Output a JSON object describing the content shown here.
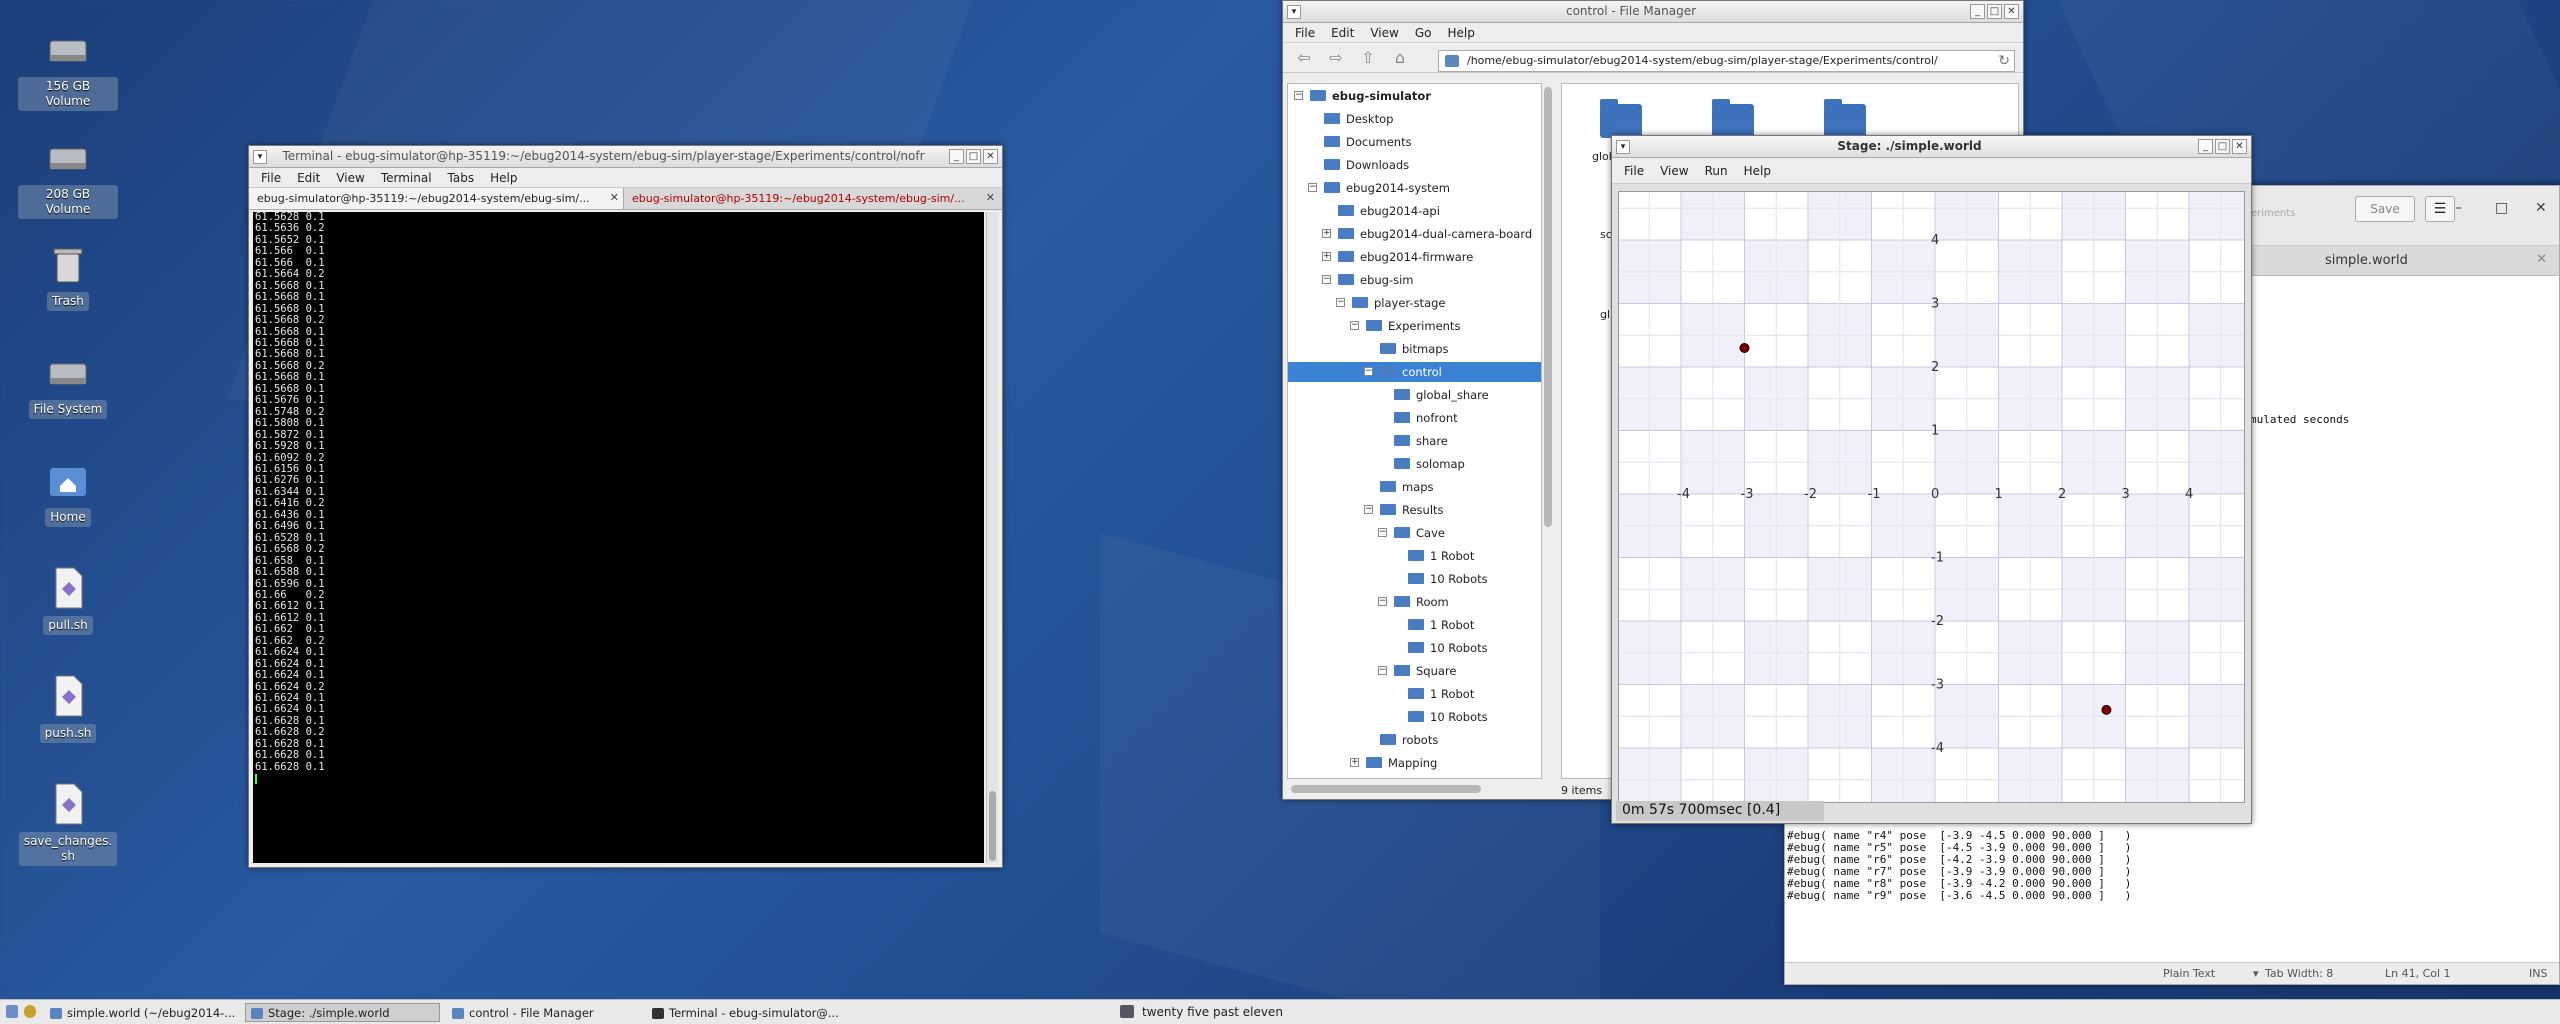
{
  "desktop": {
    "icons": [
      {
        "label": "156 GB Volume",
        "icon": "hard-drive-icon"
      },
      {
        "label": "208 GB Volume",
        "icon": "hard-drive-icon"
      },
      {
        "label": "Trash",
        "icon": "trash-icon"
      },
      {
        "label": "File System",
        "icon": "hard-drive-icon"
      },
      {
        "label": "Home",
        "icon": "home-folder-icon"
      },
      {
        "label": "pull.sh",
        "icon": "script-file-icon"
      },
      {
        "label": "push.sh",
        "icon": "script-file-icon"
      },
      {
        "label": "save_changes.\nsh",
        "icon": "script-file-icon"
      }
    ]
  },
  "terminal": {
    "title": "Terminal - ebug-simulator@hp-35119:~/ebug2014-system/ebug-sim/player-stage/Experiments/control/nofr",
    "menu": [
      "File",
      "Edit",
      "View",
      "Terminal",
      "Tabs",
      "Help"
    ],
    "tabs": [
      {
        "label": "ebug-simulator@hp-35119:~/ebug2014-system/ebug-sim/...",
        "active": true
      },
      {
        "label": "ebug-simulator@hp-35119:~/ebug2014-system/ebug-sim/...",
        "active": false
      }
    ],
    "lines": [
      "61.5628 0.1",
      "61.5636 0.2",
      "61.5652 0.1",
      "61.566  0.1",
      "61.566  0.1",
      "61.5664 0.2",
      "61.5668 0.1",
      "61.5668 0.1",
      "61.5668 0.1",
      "61.5668 0.2",
      "61.5668 0.1",
      "61.5668 0.1",
      "61.5668 0.1",
      "61.5668 0.2",
      "61.5668 0.1",
      "61.5668 0.1",
      "61.5676 0.1",
      "61.5748 0.2",
      "61.5808 0.1",
      "61.5872 0.1",
      "61.5928 0.1",
      "61.6092 0.2",
      "61.6156 0.1",
      "61.6276 0.1",
      "61.6344 0.1",
      "61.6416 0.2",
      "61.6436 0.1",
      "61.6496 0.1",
      "61.6528 0.1",
      "61.6568 0.2",
      "61.658  0.1",
      "61.6588 0.1",
      "61.6596 0.1",
      "61.66   0.2",
      "61.6612 0.1",
      "61.6612 0.1",
      "61.662  0.1",
      "61.662  0.2",
      "61.6624 0.1",
      "61.6624 0.1",
      "61.6624 0.1",
      "61.6624 0.2",
      "61.6624 0.1",
      "61.6624 0.1",
      "61.6628 0.1",
      "61.6628 0.2",
      "61.6628 0.1",
      "61.6628 0.1",
      "61.6628 0.1"
    ]
  },
  "filemanager": {
    "title": "control - File Manager",
    "menu": [
      "File",
      "Edit",
      "View",
      "Go",
      "Help"
    ],
    "path": "/home/ebug-simulator/ebug2014-system/ebug-sim/player-stage/Experiments/control/",
    "tree": [
      {
        "label": "ebug-simulator",
        "depth": 0,
        "exp": "-",
        "bold": true
      },
      {
        "label": "Desktop",
        "depth": 1
      },
      {
        "label": "Documents",
        "depth": 1
      },
      {
        "label": "Downloads",
        "depth": 1
      },
      {
        "label": "ebug2014-system",
        "depth": 1,
        "exp": "-"
      },
      {
        "label": "ebug2014-api",
        "depth": 2
      },
      {
        "label": "ebug2014-dual-camera-board",
        "depth": 2,
        "exp": "+"
      },
      {
        "label": "ebug2014-firmware",
        "depth": 2,
        "exp": "+"
      },
      {
        "label": "ebug-sim",
        "depth": 2,
        "exp": "-"
      },
      {
        "label": "player-stage",
        "depth": 3,
        "exp": "-"
      },
      {
        "label": "Experiments",
        "depth": 4,
        "exp": "-"
      },
      {
        "label": "bitmaps",
        "depth": 5
      },
      {
        "label": "control",
        "depth": 5,
        "exp": "-",
        "selected": true
      },
      {
        "label": "global_share",
        "depth": 6
      },
      {
        "label": "nofront",
        "depth": 6
      },
      {
        "label": "share",
        "depth": 6
      },
      {
        "label": "solomap",
        "depth": 6
      },
      {
        "label": "maps",
        "depth": 5
      },
      {
        "label": "Results",
        "depth": 5,
        "exp": "-"
      },
      {
        "label": "Cave",
        "depth": 6,
        "exp": "-"
      },
      {
        "label": "1 Robot",
        "depth": 7
      },
      {
        "label": "10 Robots",
        "depth": 7
      },
      {
        "label": "Room",
        "depth": 6,
        "exp": "-"
      },
      {
        "label": "1 Robot",
        "depth": 7
      },
      {
        "label": "10 Robots",
        "depth": 7
      },
      {
        "label": "Square",
        "depth": 6,
        "exp": "-"
      },
      {
        "label": "1 Robot",
        "depth": 7
      },
      {
        "label": "10 Robots",
        "depth": 7
      },
      {
        "label": "robots",
        "depth": 5
      },
      {
        "label": "Mapping",
        "depth": 4,
        "exp": "+"
      }
    ],
    "pane_labels": [
      "glob",
      "sc",
      "gl"
    ],
    "status": "9 items"
  },
  "stage": {
    "title": "Stage: ./simple.world",
    "menu": [
      "File",
      "View",
      "Run",
      "Help"
    ],
    "x_ticks": [
      "-4",
      "-3",
      "-2",
      "-1",
      "0",
      "1",
      "2",
      "3",
      "4"
    ],
    "y_ticks": [
      "4",
      "3",
      "2",
      "1",
      "-1",
      "-2",
      "-3",
      "-4"
    ],
    "robots": [
      {
        "x": -3.0,
        "y": 2.3
      },
      {
        "x": 2.7,
        "y": -3.4
      }
    ],
    "status": "0m 57s 700msec [0.4]"
  },
  "gedit": {
    "title": "simple.world",
    "save_label": "Save",
    "header_fragment": "eriments",
    "fragment": "mulated seconds",
    "lines": [
      "#ebug( name \"r4\" pose  [-3.9 -4.5 0.000 90.000 ]   )",
      "#ebug( name \"r5\" pose  [-4.5 -3.9 0.000 90.000 ]   )",
      "#ebug( name \"r6\" pose  [-4.2 -3.9 0.000 90.000 ]   )",
      "#ebug( name \"r7\" pose  [-3.9 -3.9 0.000 90.000 ]   )",
      "#ebug( name \"r8\" pose  [-3.9 -4.2 0.000 90.000 ]   )",
      "#ebug( name \"r9\" pose  [-3.6 -4.5 0.000 90.000 ]   )"
    ],
    "status_plain": "Plain Text",
    "status_tab": "Tab Width: 8",
    "status_pos": "Ln 41, Col 1",
    "status_ins": "INS"
  },
  "taskbar": {
    "tasks": [
      {
        "label": "simple.world (~/ebug2014-...",
        "active": false
      },
      {
        "label": "Stage: ./simple.world",
        "active": true
      },
      {
        "label": "control - File Manager",
        "active": false
      },
      {
        "label": "Terminal - ebug-simulator@...",
        "active": false
      }
    ],
    "clock": "twenty five past eleven"
  }
}
